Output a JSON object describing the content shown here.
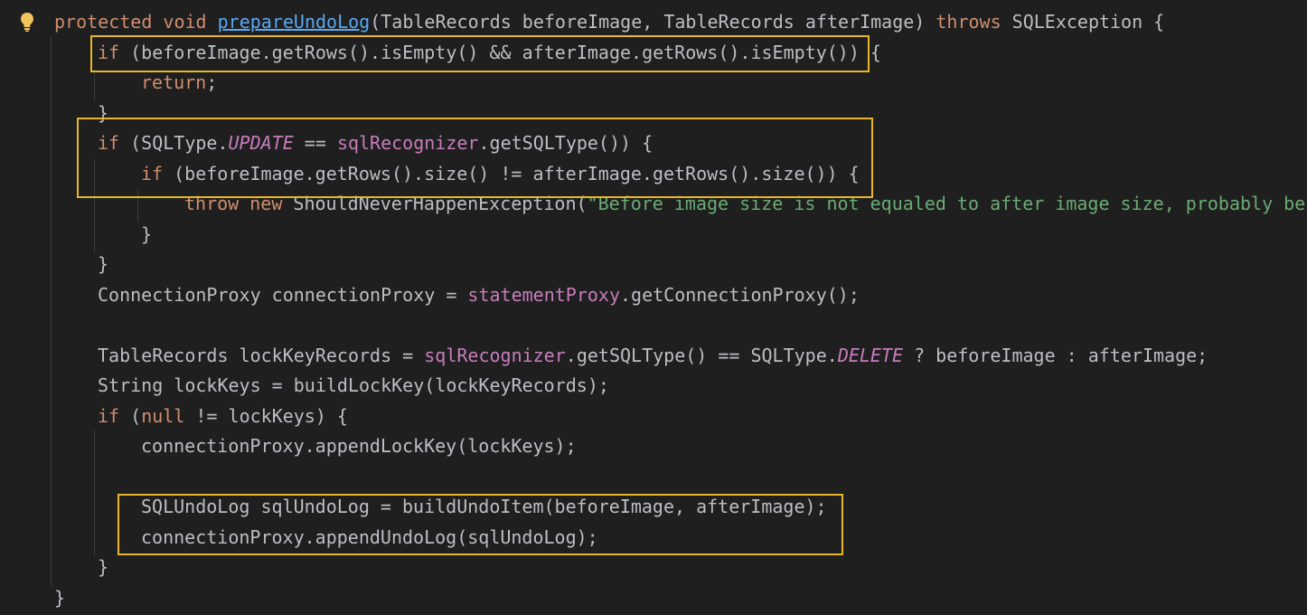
{
  "editor": {
    "gutter_icon": "lightbulb-icon",
    "accent_colors": {
      "keyword": "#cf8e6d",
      "method_decl": "#56a8f5",
      "field": "#c77dbb",
      "string": "#6aab73",
      "highlight_box": "#e8b52b"
    },
    "lines": [
      {
        "indent": 0,
        "tokens": [
          {
            "t": "protected",
            "c": "kw"
          },
          {
            "t": " "
          },
          {
            "t": "void",
            "c": "kw"
          },
          {
            "t": " "
          },
          {
            "t": "prepareUndoLog",
            "c": "fn"
          },
          {
            "t": "(TableRecords beforeImage, TableRecords afterImage) "
          },
          {
            "t": "throws",
            "c": "kw"
          },
          {
            "t": " SQLException {"
          }
        ]
      },
      {
        "indent": 1,
        "tokens": [
          {
            "t": "if",
            "c": "kw"
          },
          {
            "t": " (beforeImage.getRows().isEmpty() && afterImage.getRows().isEmpty()) {"
          }
        ]
      },
      {
        "indent": 2,
        "tokens": [
          {
            "t": "return",
            "c": "kw"
          },
          {
            "t": ";"
          }
        ]
      },
      {
        "indent": 1,
        "tokens": [
          {
            "t": "}"
          }
        ]
      },
      {
        "indent": 1,
        "tokens": [
          {
            "t": "if",
            "c": "kw"
          },
          {
            "t": " (SQLType."
          },
          {
            "t": "UPDATE",
            "c": "const"
          },
          {
            "t": " == "
          },
          {
            "t": "sqlRecognizer",
            "c": "field"
          },
          {
            "t": ".getSQLType()) {"
          }
        ]
      },
      {
        "indent": 2,
        "tokens": [
          {
            "t": "if",
            "c": "kw"
          },
          {
            "t": " (beforeImage.getRows().size() != afterImage.getRows().size()) {"
          }
        ]
      },
      {
        "indent": 3,
        "tokens": [
          {
            "t": "throw",
            "c": "kw"
          },
          {
            "t": " "
          },
          {
            "t": "new",
            "c": "kw"
          },
          {
            "t": " ShouldNeverHappenException("
          },
          {
            "t": "\"Before image size is not equaled to after image size, probably bec",
            "c": "str"
          }
        ]
      },
      {
        "indent": 2,
        "tokens": [
          {
            "t": "}"
          }
        ]
      },
      {
        "indent": 1,
        "tokens": [
          {
            "t": "}"
          }
        ]
      },
      {
        "indent": 1,
        "tokens": [
          {
            "t": "ConnectionProxy connectionProxy = "
          },
          {
            "t": "statementProxy",
            "c": "field"
          },
          {
            "t": ".getConnectionProxy();"
          }
        ]
      },
      {
        "indent": 1,
        "tokens": []
      },
      {
        "indent": 1,
        "tokens": [
          {
            "t": "TableRecords lockKeyRecords = "
          },
          {
            "t": "sqlRecognizer",
            "c": "field"
          },
          {
            "t": ".getSQLType() == SQLType."
          },
          {
            "t": "DELETE",
            "c": "const"
          },
          {
            "t": " ? beforeImage : afterImage;"
          }
        ]
      },
      {
        "indent": 1,
        "tokens": [
          {
            "t": "String lockKeys = buildLockKey(lockKeyRecords);"
          }
        ]
      },
      {
        "indent": 1,
        "tokens": [
          {
            "t": "if",
            "c": "kw"
          },
          {
            "t": " ("
          },
          {
            "t": "null",
            "c": "kw"
          },
          {
            "t": " != lockKeys) {"
          }
        ]
      },
      {
        "indent": 2,
        "tokens": [
          {
            "t": "connectionProxy.appendLockKey(lockKeys);"
          }
        ]
      },
      {
        "indent": 2,
        "tokens": []
      },
      {
        "indent": 2,
        "tokens": [
          {
            "t": "SQLUndoLog sqlUndoLog = buildUndoItem(beforeImage, afterImage);"
          }
        ]
      },
      {
        "indent": 2,
        "tokens": [
          {
            "t": "connectionProxy.appendUndoLog(sqlUndoLog);"
          }
        ]
      },
      {
        "indent": 1,
        "tokens": [
          {
            "t": "}"
          }
        ]
      },
      {
        "indent": 0,
        "tokens": [
          {
            "t": "}"
          }
        ]
      }
    ]
  }
}
